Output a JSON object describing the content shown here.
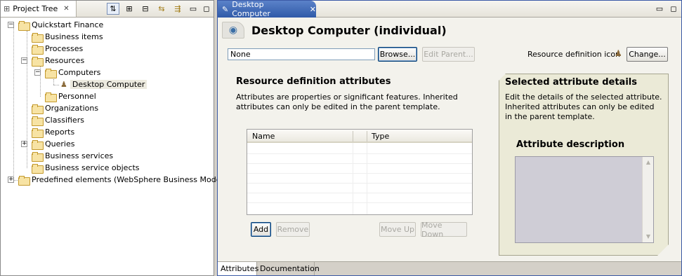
{
  "left_panel": {
    "tab_title": "Project Tree",
    "tree": [
      {
        "label": "Quickstart Finance",
        "level": 0,
        "expanded": true
      },
      {
        "label": "Business items",
        "level": 1
      },
      {
        "label": "Processes",
        "level": 1
      },
      {
        "label": "Resources",
        "level": 1,
        "expanded": true
      },
      {
        "label": "Computers",
        "level": 2,
        "expanded": true
      },
      {
        "label": "Desktop Computer",
        "level": 3,
        "selected": true
      },
      {
        "label": "Personnel",
        "level": 2
      },
      {
        "label": "Organizations",
        "level": 1
      },
      {
        "label": "Classifiers",
        "level": 1
      },
      {
        "label": "Reports",
        "level": 1
      },
      {
        "label": "Queries",
        "level": 1,
        "expanded": false
      },
      {
        "label": "Business services",
        "level": 1
      },
      {
        "label": "Business service objects",
        "level": 1
      },
      {
        "label": "Predefined elements (WebSphere Business Modeler)",
        "level": 0,
        "expanded": false
      }
    ]
  },
  "editor": {
    "tab_title": "Desktop Computer",
    "page_title": "Desktop Computer (individual)",
    "parent_field_value": "None",
    "browse_label": "Browse...",
    "edit_parent_label": "Edit Parent...",
    "icon_label": "Resource definition icon",
    "change_label": "Change...",
    "attributes_section": {
      "title": "Resource definition attributes",
      "description": "Attributes are properties or significant features. Inherited attributes can only be edited in the parent template.",
      "columns": [
        "Name",
        "Type"
      ],
      "add_label": "Add",
      "remove_label": "Remove",
      "move_up_label": "Move Up",
      "move_down_label": "Move Down"
    },
    "details_section": {
      "title": "Selected attribute details",
      "description": "Edit the details of the selected attribute. Inherited attributes can only be edited in the parent template.",
      "attr_desc_title": "Attribute description"
    },
    "bottom_tabs": [
      "Attributes",
      "Documentation"
    ]
  },
  "colors": {
    "editor_tab": "#2f5aa8",
    "folder": "#f7e3a4",
    "panel_bg": "#ebead7"
  }
}
